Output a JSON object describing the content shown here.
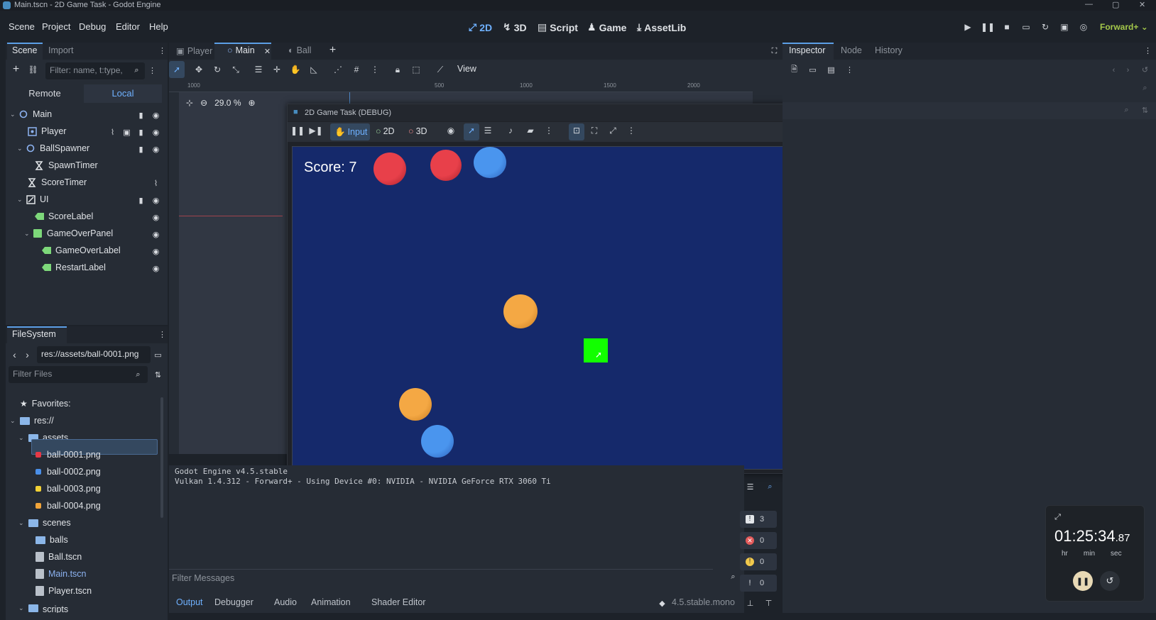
{
  "window": {
    "title": "Main.tscn - 2D Game Task - Godot Engine"
  },
  "menu": [
    "Scene",
    "Project",
    "Debug",
    "Editor",
    "Help"
  ],
  "modes": {
    "m2d": "2D",
    "m3d": "3D",
    "script": "Script",
    "game": "Game",
    "assetlib": "AssetLib"
  },
  "renderer": "Forward+",
  "scene_dock": {
    "tabs": [
      "Scene",
      "Import"
    ],
    "filter_placeholder": "Filter: name, t:type,",
    "remote": "Remote",
    "local": "Local",
    "tree": [
      {
        "label": "Main"
      },
      {
        "label": "Player"
      },
      {
        "label": "BallSpawner"
      },
      {
        "label": "SpawnTimer"
      },
      {
        "label": "ScoreTimer"
      },
      {
        "label": "UI"
      },
      {
        "label": "ScoreLabel"
      },
      {
        "label": "GameOverPanel"
      },
      {
        "label": "GameOverLabel"
      },
      {
        "label": "RestartLabel"
      }
    ]
  },
  "filesystem": {
    "title": "FileSystem",
    "path": "res://assets/ball-0001.png",
    "filter_placeholder": "Filter Files",
    "items": [
      {
        "label": "Favorites:"
      },
      {
        "label": "res://"
      },
      {
        "label": "assets"
      },
      {
        "label": "ball-0001.png",
        "color": "#e63946"
      },
      {
        "label": "ball-0002.png",
        "color": "#4a8fe8"
      },
      {
        "label": "ball-0003.png",
        "color": "#f2d135"
      },
      {
        "label": "ball-0004.png",
        "color": "#f2a53a"
      },
      {
        "label": "scenes"
      },
      {
        "label": "balls"
      },
      {
        "label": "Ball.tscn"
      },
      {
        "label": "Main.tscn"
      },
      {
        "label": "Player.tscn"
      },
      {
        "label": "scripts"
      }
    ]
  },
  "editor_tabs": [
    "Player",
    "Main",
    "Ball"
  ],
  "toolbar": {
    "view": "View",
    "zoom": "29.0 %"
  },
  "ruler_ticks": [
    "1000",
    "500",
    "1000",
    "1500",
    "2000"
  ],
  "game_window": {
    "title": "2D Game Task (DEBUG)",
    "input": "Input",
    "t2d": "2D",
    "t3d": "3D",
    "resolution": "960x540",
    "score": "Score: 7",
    "balls": [
      {
        "color": "#e8404a",
        "shade": "#a81f2a"
      },
      {
        "color": "#e8404a",
        "shade": "#a81f2a"
      },
      {
        "color": "#4a95ee",
        "shade": "#2c5fb8"
      },
      {
        "color": "#4a95ee",
        "shade": "#2c5fb8"
      },
      {
        "color": "#f5d83a",
        "shade": "#c9a81a"
      },
      {
        "color": "#f4a844",
        "shade": "#c87a1e"
      },
      {
        "color": "#f4a844",
        "shade": "#c87a1e"
      },
      {
        "color": "#4a95ee",
        "shade": "#2c5fb8"
      }
    ],
    "player_color": "#12ff00"
  },
  "output": {
    "line1": "Godot Engine v4.5.stable",
    "line2": "Vulkan 1.4.312 - Forward+ - Using Device #0: NVIDIA - NVIDIA GeForce RTX 3060 Ti",
    "filter_placeholder": "Filter Messages",
    "counters": [
      "3",
      "0",
      "0",
      "0"
    ],
    "tabs": [
      "Output",
      "Debugger",
      "Audio",
      "Animation",
      "Shader Editor"
    ],
    "version": "4.5.stable.mono"
  },
  "inspector": {
    "tabs": [
      "Inspector",
      "Node",
      "History"
    ]
  },
  "clock": {
    "time": "01:25:34",
    "fraction": ".87",
    "labels": [
      "hr",
      "min",
      "sec"
    ]
  }
}
